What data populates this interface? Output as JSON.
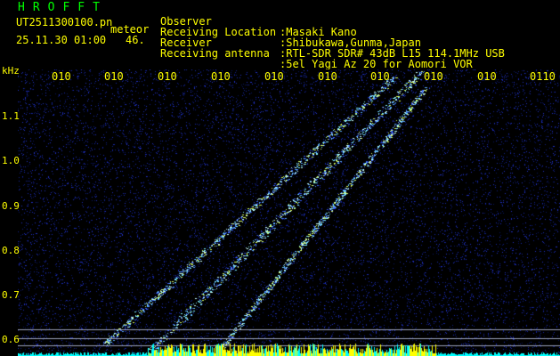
{
  "header": {
    "app_title": "HROFFT",
    "file_name": "UT2511300100.pn",
    "tag": "meteor",
    "timestamp": "25.11.30 01:00",
    "count": "46."
  },
  "info": [
    {
      "label": "Observer",
      "value": ":Masaki Kano"
    },
    {
      "label": "Receiving Location",
      "value": ":Shibukawa,Gunma,Japan"
    },
    {
      "label": "Receiver",
      "value": ":RTL-SDR SDR# 43dB L15 114.1MHz USB"
    },
    {
      "label": "Receiving antenna",
      "value": ":5el Yagi Az 20 for Aomori VOR"
    }
  ],
  "axis": {
    "unit": "kHz",
    "y_ticks": [
      "1.1",
      "1.0",
      "0.9",
      "0.8",
      "0.7",
      "0.6"
    ],
    "x_ticks": [
      "010",
      "010",
      "010",
      "010",
      "010",
      "010",
      "010",
      "010",
      "010",
      "0110"
    ]
  },
  "colors": {
    "background": "#000000",
    "text": "#ffff00",
    "title": "#00ff00",
    "noise": "#1a2a9a",
    "trace": "#7ff0ff",
    "baseline": "#00ffff"
  }
}
